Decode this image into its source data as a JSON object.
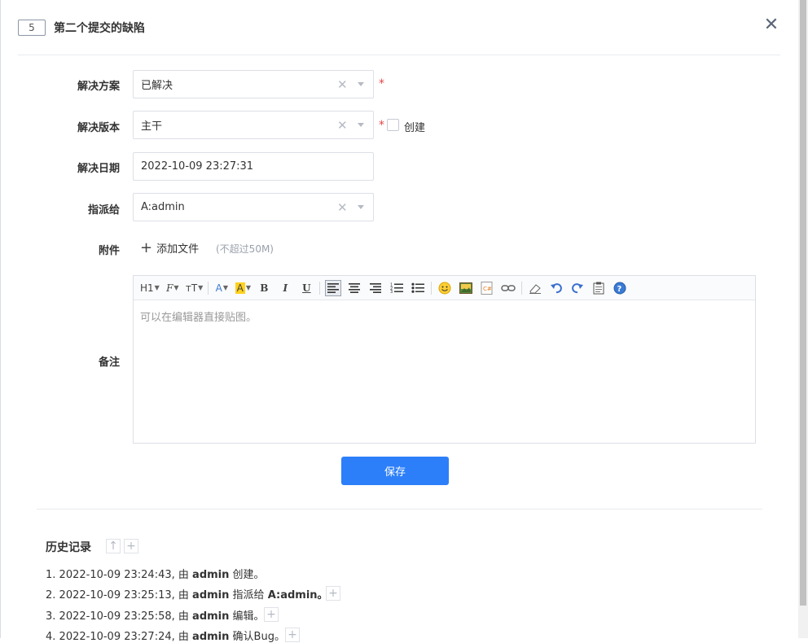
{
  "header": {
    "id": "5",
    "title": "第二个提交的缺陷"
  },
  "form": {
    "resolution": {
      "label": "解决方案",
      "value": "已解决",
      "required_mark": "*"
    },
    "build": {
      "label": "解决版本",
      "value": "主干",
      "required_mark": "*",
      "create_label": "创建"
    },
    "date": {
      "label": "解决日期",
      "value": "2022-10-09 23:27:31"
    },
    "assign": {
      "label": "指派给",
      "value": "A:admin"
    },
    "files": {
      "label": "附件",
      "add_label": "添加文件",
      "limit": "(不超过50M)"
    },
    "comment": {
      "label": "备注",
      "placeholder": "可以在编辑器直接贴图。"
    }
  },
  "toolbar": {
    "heading": "H1",
    "font": "F",
    "size": "тT",
    "font_color": "A",
    "bg_color": "A",
    "bold": "B",
    "italic": "I",
    "underline": "U"
  },
  "actions": {
    "save": "保存"
  },
  "history": {
    "title": "历史记录",
    "items": [
      {
        "num": "1.",
        "time": "2022-10-09 23:24:43,",
        "by": "由",
        "user": "admin",
        "action": "创建。",
        "target": ""
      },
      {
        "num": "2.",
        "time": "2022-10-09 23:25:13,",
        "by": "由",
        "user": "admin",
        "action": "指派给",
        "target": "A:admin。"
      },
      {
        "num": "3.",
        "time": "2022-10-09 23:25:58,",
        "by": "由",
        "user": "admin",
        "action": "编辑。",
        "target": ""
      },
      {
        "num": "4.",
        "time": "2022-10-09 23:27:24,",
        "by": "由",
        "user": "admin",
        "action": "确认Bug。",
        "target": ""
      }
    ]
  },
  "colors": {
    "primary": "#2d7ff9",
    "required": "#e54545"
  }
}
